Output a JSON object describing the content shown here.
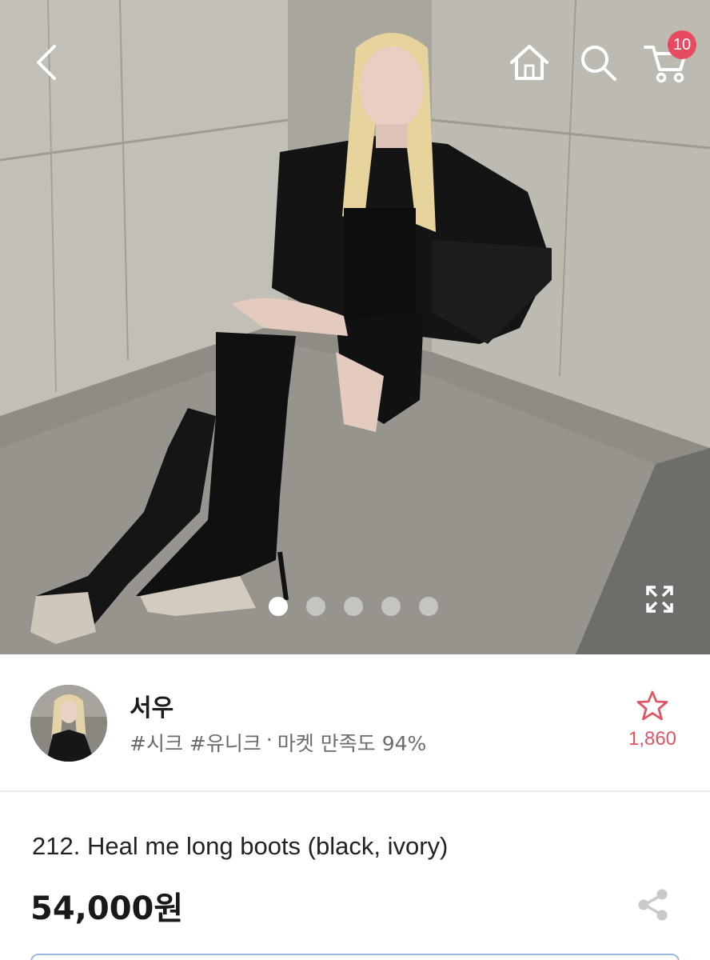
{
  "header": {
    "cart_badge_count": "10",
    "icons": [
      "back-icon",
      "home-icon",
      "search-icon",
      "cart-icon"
    ]
  },
  "gallery": {
    "total_images": 5,
    "active_index": 0,
    "expand_icon": "expand-icon"
  },
  "seller": {
    "name": "서우",
    "tags": "#시크 #유니크",
    "separator": "·",
    "satisfaction": "마켓 만족도 94%",
    "favorite_icon": "star-outline-icon",
    "favorite_count": "1,860"
  },
  "product": {
    "title": "212. Heal me long boots (black, ivory)",
    "price": "54,000원",
    "share_icon": "share-icon"
  },
  "colors": {
    "accent": "#e84a5f",
    "favorite_count": "#e05563",
    "muted_text": "#6b6b6b"
  }
}
